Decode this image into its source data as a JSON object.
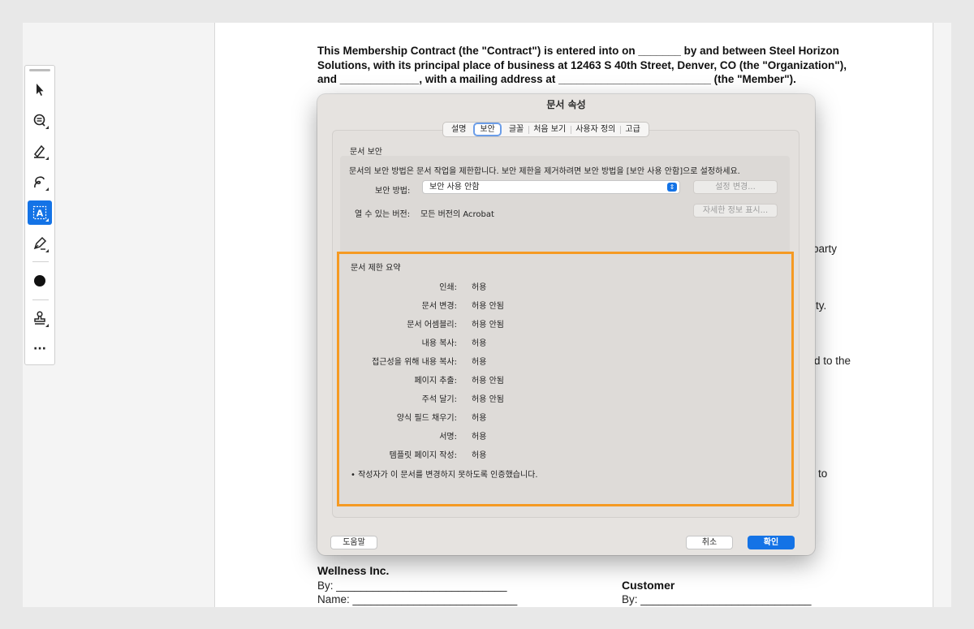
{
  "toolbar": {
    "tools": [
      "select-pointer-icon",
      "add-comment-icon",
      "highlight-pen-icon",
      "draw-freehand-icon",
      "text-select-icon",
      "sign-pen-icon",
      "color-swatch-icon",
      "stamp-icon",
      "more-icon"
    ],
    "more_label": "···",
    "accent": "#1473e6"
  },
  "document": {
    "contract_text": "This Membership Contract (the \"Contract\") is entered into on _______ by and between Steel Horizon Solutions, with its principal place of business at 12463 S 40th Street, Denver, CO (the \"Organization\"), and _____________, with a mailing address at _________________________ (the \"Member\").",
    "fragments": [
      "party",
      "ty.",
      "d to the",
      "to"
    ],
    "org_name": "Wellness Inc.",
    "by_line": "By: ____________________________",
    "name_line": "Name: ___________________________",
    "customer_label": "Customer",
    "customer_by_line": "By: ____________________________"
  },
  "dialog": {
    "title": "문서 속성",
    "tabs": [
      "설명",
      "보안",
      "글꼴",
      "처음 보기",
      "사용자 정의",
      "고급"
    ],
    "selected_tab": "보안",
    "security_section_label": "문서 보안",
    "security_desc": "문서의 보안 방법은 문서 작업을 제한합니다. 보안 제한을 제거하려면 보안 방법을 [보안 사용 안함]으로 설정하세요.",
    "method_label": "보안 방법:",
    "method_value": "보안 사용 안함",
    "change_settings_button": "설정 변경...",
    "compat_label": "열 수 있는 버전:",
    "compat_value": "모든 버전의 Acrobat",
    "show_details_button": "자세한 정보 표시...",
    "summary_label": "문서 제한 요약",
    "restrictions": [
      {
        "key": "인쇄:",
        "value": "허용"
      },
      {
        "key": "문서 변경:",
        "value": "허용 안됨"
      },
      {
        "key": "문서 어셈블리:",
        "value": "허용 안됨"
      },
      {
        "key": "내용 복사:",
        "value": "허용"
      },
      {
        "key": "접근성을 위해 내용 복사:",
        "value": "허용"
      },
      {
        "key": "페이지 추출:",
        "value": "허용 안됨"
      },
      {
        "key": "주석 달기:",
        "value": "허용 안됨"
      },
      {
        "key": "양식 필드 채우기:",
        "value": "허용"
      },
      {
        "key": "서명:",
        "value": "허용"
      },
      {
        "key": "템플릿 페이지 작성:",
        "value": "허용"
      }
    ],
    "certified_note": "•   작성자가 이 문서를 변경하지 못하도록 인증했습니다.",
    "help_button": "도움말",
    "cancel_button": "취소",
    "ok_button": "확인",
    "highlight_color": "#f59a23"
  }
}
